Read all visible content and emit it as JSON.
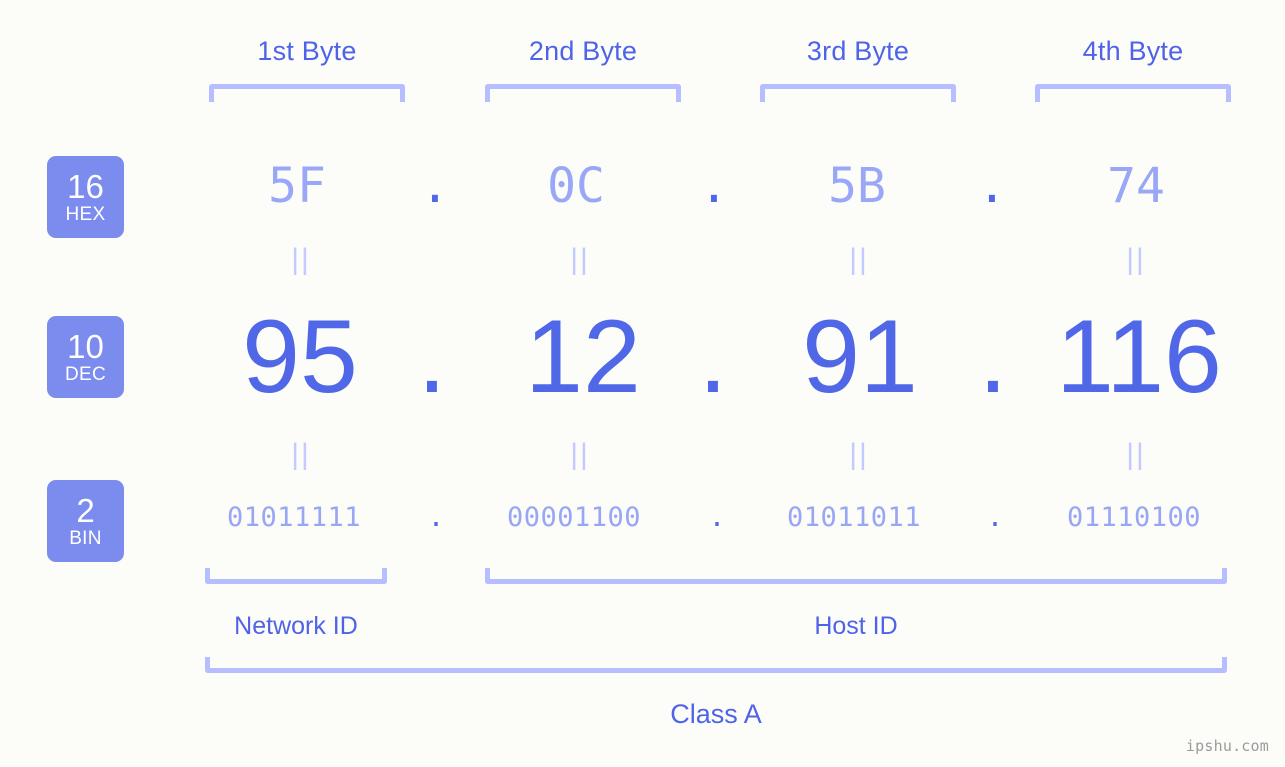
{
  "meta": {
    "background": "#fcfdf9",
    "accent": "#5068e8",
    "accent_light": "#9aa6f6",
    "bracket": "#b6beff",
    "badge_bg": "#7b8bee",
    "watermark": "ipshu.com"
  },
  "byte_headers": [
    {
      "label": "1st Byte"
    },
    {
      "label": "2nd Byte"
    },
    {
      "label": "3rd Byte"
    },
    {
      "label": "4th Byte"
    }
  ],
  "rows": {
    "hex": {
      "base": "16",
      "base_name": "HEX",
      "values": [
        "5F",
        "0C",
        "5B",
        "74"
      ],
      "separator": "."
    },
    "dec": {
      "base": "10",
      "base_name": "DEC",
      "values": [
        "95",
        "12",
        "91",
        "116"
      ],
      "separator": "."
    },
    "bin": {
      "base": "2",
      "base_name": "BIN",
      "values": [
        "01011111",
        "00001100",
        "01011011",
        "01110100"
      ],
      "separator": "."
    }
  },
  "equals_marks": {
    "glyph": "||"
  },
  "sections": {
    "network_id": "Network ID",
    "host_id": "Host ID",
    "class": "Class A"
  }
}
